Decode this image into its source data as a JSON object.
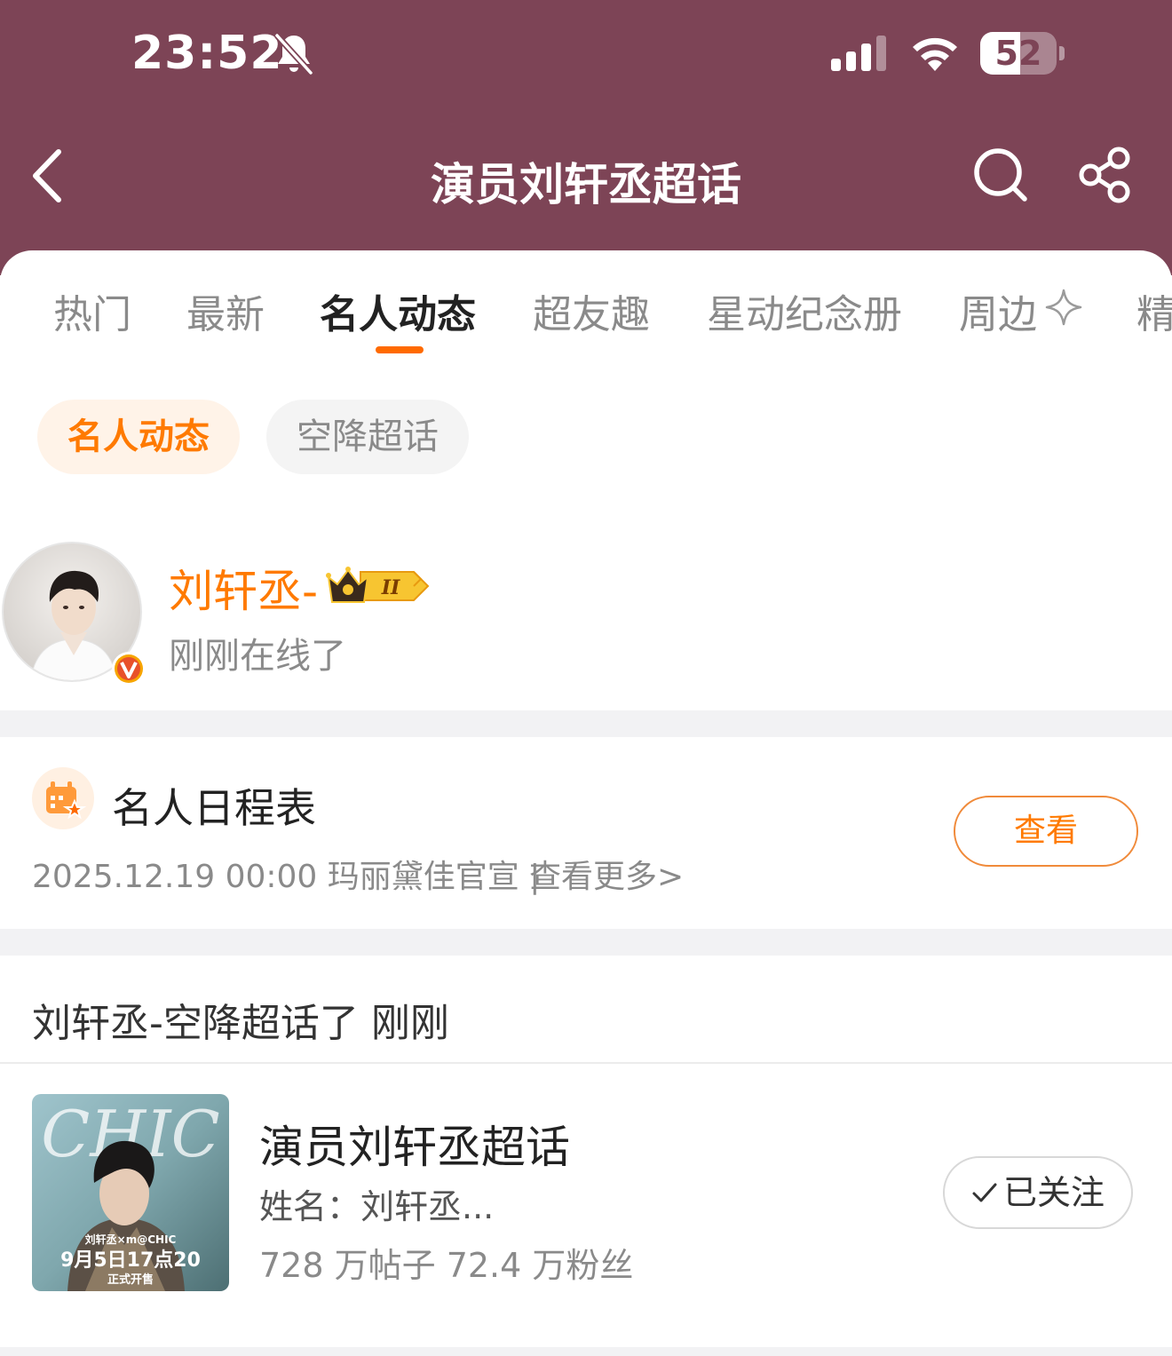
{
  "status_bar": {
    "time": "23:52",
    "battery": "52",
    "battery_level": 0.52
  },
  "nav": {
    "title": "演员刘轩丞超话"
  },
  "tabs": [
    {
      "label": "热门"
    },
    {
      "label": "最新"
    },
    {
      "label": "名人动态"
    },
    {
      "label": "超友趣"
    },
    {
      "label": "星动纪念册"
    },
    {
      "label": "周边"
    },
    {
      "label": "精"
    }
  ],
  "active_tab": "名人动态",
  "filter_chips": [
    {
      "label": "名人动态"
    },
    {
      "label": "空降超话"
    }
  ],
  "celebrity": {
    "name": "刘轩丞-",
    "badge_level": "II",
    "status": "刚刚在线了"
  },
  "schedule": {
    "title": "名人日程表",
    "meta": "2025.12.19 00:00 玛丽黛佳官宣 |",
    "more": "查看更多>",
    "button": "查看"
  },
  "activity": {
    "text": "刘轩丞-空降超话了 刚刚"
  },
  "topic_card": {
    "name": "演员刘轩丞超话",
    "desc": "姓名：刘轩丞...",
    "stats": "728 万帖子  72.4 万粉丝",
    "follow_label": "已关注",
    "cover_brand": "CHIC",
    "cover_caption": "刘轩丞×m@CHIC",
    "cover_date": "9月5日17点20",
    "cover_sale": "正式开售"
  },
  "colors": {
    "header_bg": "#7d4456",
    "accent": "#ff7a00"
  },
  "icons": [
    "back-arrow-icon",
    "search-icon",
    "share-icon",
    "mute-bell-icon",
    "signal-icon",
    "wifi-icon",
    "sparkle-icon",
    "verified-icon",
    "crown-badge-icon",
    "calendar-star-icon",
    "check-icon"
  ]
}
